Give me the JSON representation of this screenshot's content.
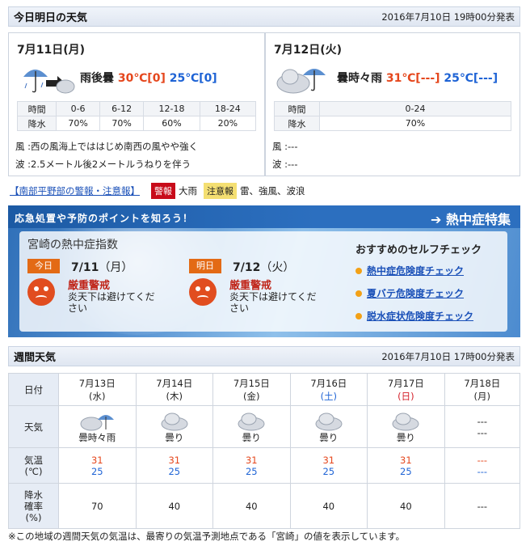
{
  "today_section": {
    "title": "今日明日の天気",
    "issued": "2016年7月10日 19時00分発表",
    "days": [
      {
        "date": "7月11日(月)",
        "icon": "rain-then-cloudy-icon",
        "weather": "雨後曇",
        "high": "30℃[0]",
        "low": "25℃[0]",
        "rain_headers": [
          "時間",
          "0-6",
          "6-12",
          "12-18",
          "18-24"
        ],
        "rain_values": [
          "降水",
          "70%",
          "70%",
          "60%",
          "20%"
        ],
        "wind": "風 :西の風海上でははじめ南西の風やや強く",
        "wave": "波 :2.5メートル後2メートルうねりを伴う"
      },
      {
        "date": "7月12日(火)",
        "icon": "cloudy-sometimes-rain-icon",
        "weather": "曇時々雨",
        "high": "31℃[---]",
        "low": "25℃[---]",
        "rain_headers": [
          "時間",
          "0-24"
        ],
        "rain_values": [
          "降水",
          "70%"
        ],
        "wind": "風 :---",
        "wave": "波 :---"
      }
    ]
  },
  "warnings": {
    "link": "【南部平野部の警報・注意報】",
    "warning_label": "警報",
    "warning_items": "大雨",
    "advisory_label": "注意報",
    "advisory_items": "雷、強風、波浪"
  },
  "heat_banner": {
    "headline": "応急処置や予防のポイントを知ろう！",
    "feature_link": "熱中症特集",
    "index_title_place": "宮崎",
    "index_title_rest": "の熱中症指数",
    "days": [
      {
        "tag": "今日",
        "date": "7/11",
        "dow": "（月）",
        "level": "厳重警戒",
        "advice": "炎天下は避けてください"
      },
      {
        "tag": "明日",
        "date": "7/12",
        "dow": "（火）",
        "level": "厳重警戒",
        "advice": "炎天下は避けてください"
      }
    ],
    "check_title": "おすすめのセルフチェック",
    "checks": [
      "熱中症危険度チェック",
      "夏バテ危険度チェック",
      "脱水症状危険度チェック"
    ]
  },
  "weekly": {
    "title": "週間天気",
    "issued": "2016年7月10日 17時00分発表",
    "row_labels": {
      "date": "日付",
      "weather": "天気",
      "temp": "気温\n(℃)",
      "rain": "降水\n確率\n(%)"
    },
    "days": [
      {
        "date": "7月13日",
        "dow": "(水)",
        "dow_type": "normal",
        "weather": "曇時々雨",
        "icon": "cloudy-sometimes-rain-icon",
        "high": "31",
        "low": "25",
        "rain": "70"
      },
      {
        "date": "7月14日",
        "dow": "(木)",
        "dow_type": "normal",
        "weather": "曇り",
        "icon": "cloudy-icon",
        "high": "31",
        "low": "25",
        "rain": "40"
      },
      {
        "date": "7月15日",
        "dow": "(金)",
        "dow_type": "normal",
        "weather": "曇り",
        "icon": "cloudy-icon",
        "high": "31",
        "low": "25",
        "rain": "40"
      },
      {
        "date": "7月16日",
        "dow": "(土)",
        "dow_type": "sat",
        "weather": "曇り",
        "icon": "cloudy-icon",
        "high": "31",
        "low": "25",
        "rain": "40"
      },
      {
        "date": "7月17日",
        "dow": "(日)",
        "dow_type": "sun",
        "weather": "曇り",
        "icon": "cloudy-icon",
        "high": "31",
        "low": "25",
        "rain": "40"
      },
      {
        "date": "7月18日",
        "dow": "(月)",
        "dow_type": "normal",
        "weather": "---",
        "weather2": "---",
        "icon": "",
        "high": "---",
        "low": "---",
        "rain": "---"
      }
    ],
    "note": "※この地域の週間天気の気温は、最寄りの気温予測地点である「宮崎」の値を表示しています。"
  }
}
